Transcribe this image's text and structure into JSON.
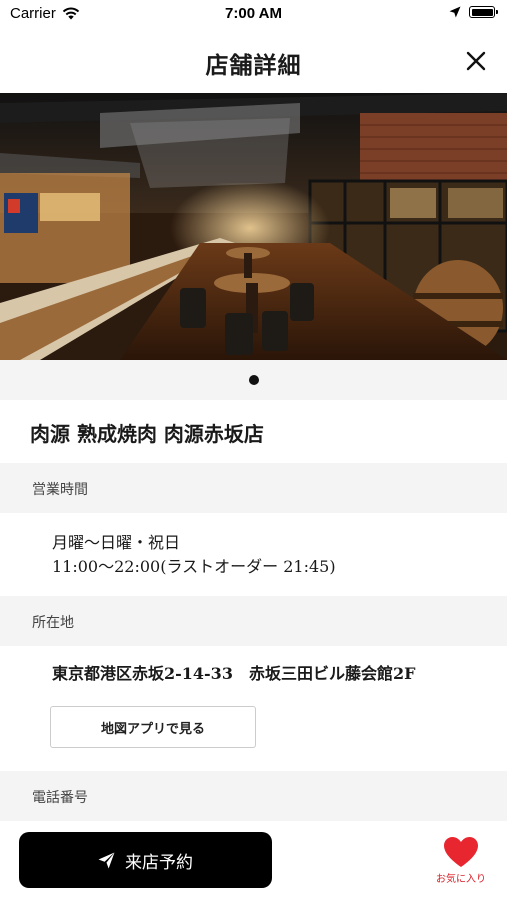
{
  "status_bar": {
    "carrier": "Carrier",
    "time": "7:00 AM"
  },
  "nav": {
    "title": "店舗詳細",
    "close_icon": "close-icon"
  },
  "store": {
    "name": "肉源 熟成焼肉 肉源赤坂店"
  },
  "hours": {
    "header": "営業時間",
    "days": "月曜〜日曜・祝日",
    "time": "11:00〜22:00(ラストオーダー 21:45)"
  },
  "location": {
    "header": "所在地",
    "address": "東京都港区赤坂2-14-33　赤坂三田ビル藤会館2F",
    "map_button_label": "地図アプリで見る"
  },
  "phone": {
    "header": "電話番号"
  },
  "actions": {
    "reserve_label": "来店予約",
    "reserve_icon": "send-icon",
    "favorite_label": "お気に入り",
    "favorite_icon": "heart-icon"
  },
  "colors": {
    "accent": "#d8232a",
    "primary_button": "#000000",
    "section_bg": "#f4f4f4"
  }
}
